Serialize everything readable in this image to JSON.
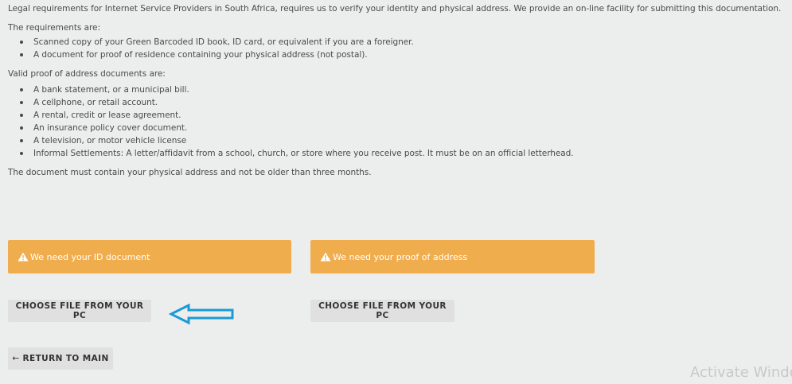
{
  "intro": {
    "legal_text": "Legal requirements for Internet Service Providers in South Africa, requires us to verify your identity and physical address. We provide an on-line facility for submitting this documentation.",
    "requirements_heading": "The requirements are:",
    "requirements": [
      "Scanned copy of your Green Barcoded ID book, ID card, or equivalent if you are a foreigner.",
      "A document for proof of residence containing your physical address (not postal)."
    ],
    "valid_heading": "Valid proof of address documents are:",
    "valid_documents": [
      "A bank statement, or a municipal bill.",
      "A cellphone, or retail account.",
      "A rental, credit or lease agreement.",
      "An insurance policy cover document.",
      "A television, or motor vehicle license",
      "Informal Settlements: A letter/affidavit from a school, church, or store where you receive post. It must be on an official letterhead."
    ],
    "note": "The document must contain your physical address and not be older than three months."
  },
  "alerts": {
    "id_document": "We need your ID document",
    "proof_of_address": "We need your proof of address",
    "icon": "warning-icon"
  },
  "buttons": {
    "choose_file_id": "CHOOSE FILE FROM YOUR PC",
    "choose_file_address": "CHOOSE FILE FROM YOUR PC",
    "return_main": "RETURN TO MAIN",
    "return_icon": "arrow-left-icon"
  },
  "watermark": {
    "text": "Activate Windo"
  },
  "colors": {
    "background": "#eceeed",
    "alert": "#f0ad4e",
    "button": "#e0e0e0",
    "annotation_arrow": "#1a9ad6"
  }
}
